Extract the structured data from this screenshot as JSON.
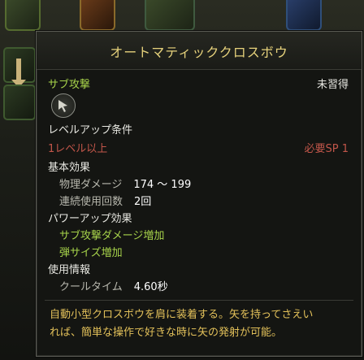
{
  "tooltip": {
    "title": "オートマティッククロスボウ",
    "category": "サブ攻撃",
    "learn_status": "未習得",
    "level_condition_header": "レベルアップ条件",
    "level_requirement": "1レベル以上",
    "sp_requirement": "必要SP 1",
    "base_effect_header": "基本効果",
    "physical_damage_label": "物理ダメージ",
    "physical_damage_value": "174 ～ 199",
    "consecutive_uses_label": "連続使用回数",
    "consecutive_uses_value": "2回",
    "powerup_header": "パワーアップ効果",
    "powerup_effects": [
      "サブ攻撃ダメージ増加",
      "弾サイズ増加"
    ],
    "usage_info_header": "使用情報",
    "cooldown_label": "クールタイム",
    "cooldown_value": "4.60秒",
    "description_line1": "自動小型クロスボウを肩に装着する。矢を持ってさえい",
    "description_line2": "れば、簡単な操作で好きな時に矢の発射が可能。"
  },
  "colors": {
    "title": "#e7d27c",
    "green": "#a6d24a",
    "red": "#c2564a",
    "description": "#e3c15a"
  },
  "icons": {
    "skill_icon": "crossbow-bolt-icon"
  }
}
